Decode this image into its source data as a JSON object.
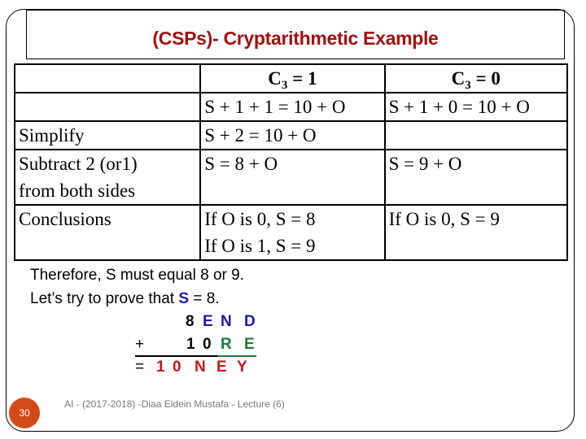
{
  "slide": {
    "title": "(CSPs)- Cryptarithmetic Example",
    "table": {
      "headers": [
        {
          "label": ""
        },
        {
          "base": "C",
          "sub": "3",
          "rest": " = 1"
        },
        {
          "base": "C",
          "sub": "3",
          "rest": " = 0"
        }
      ],
      "rows": [
        {
          "label": "",
          "c3_1": [
            "S + 1 + 1 = 10 + O"
          ],
          "c3_0": [
            "S + 1 + 0 = 10 + O"
          ]
        },
        {
          "label": "Simplify",
          "c3_1": [
            "S + 2 = 10 + O"
          ],
          "c3_0": [
            ""
          ]
        },
        {
          "label": "Subtract 2 (or1) from both sides",
          "label_lines": [
            "Subtract 2 (or1)",
            "from both sides"
          ],
          "c3_1": [
            "S = 8 + O"
          ],
          "c3_0": [
            "S = 9 + O"
          ]
        },
        {
          "label": "Conclusions",
          "c3_1": [
            "If  O is 0, S = 8",
            "If  O is 1, S = 9"
          ],
          "c3_0": [
            "If  O is 0, S = 9"
          ]
        }
      ]
    },
    "body": {
      "line1": "Therefore, S must equal 8 or 9.",
      "line2_prefix": "Let’s try to prove that ",
      "line2_highlight": "S",
      "line2_suffix": " = 8."
    },
    "puzzle": {
      "row1": [
        "8",
        "E",
        "N",
        "D"
      ],
      "row2_op": "+",
      "row2": [
        "1",
        "0",
        "R",
        "E"
      ],
      "row3_op": "=",
      "row3": [
        "1",
        "0",
        "N",
        "E",
        "Y"
      ]
    },
    "colors": {
      "title": "#a50f0f",
      "blue": "#1a1aa6",
      "green": "#1f7a3a",
      "red": "#c8141e",
      "badge": "#d24a17"
    },
    "footer": {
      "page_number": "30",
      "caption": "AI - (2017-2018) -Diaa Eldein Mustafa - Lecture (6)"
    }
  }
}
